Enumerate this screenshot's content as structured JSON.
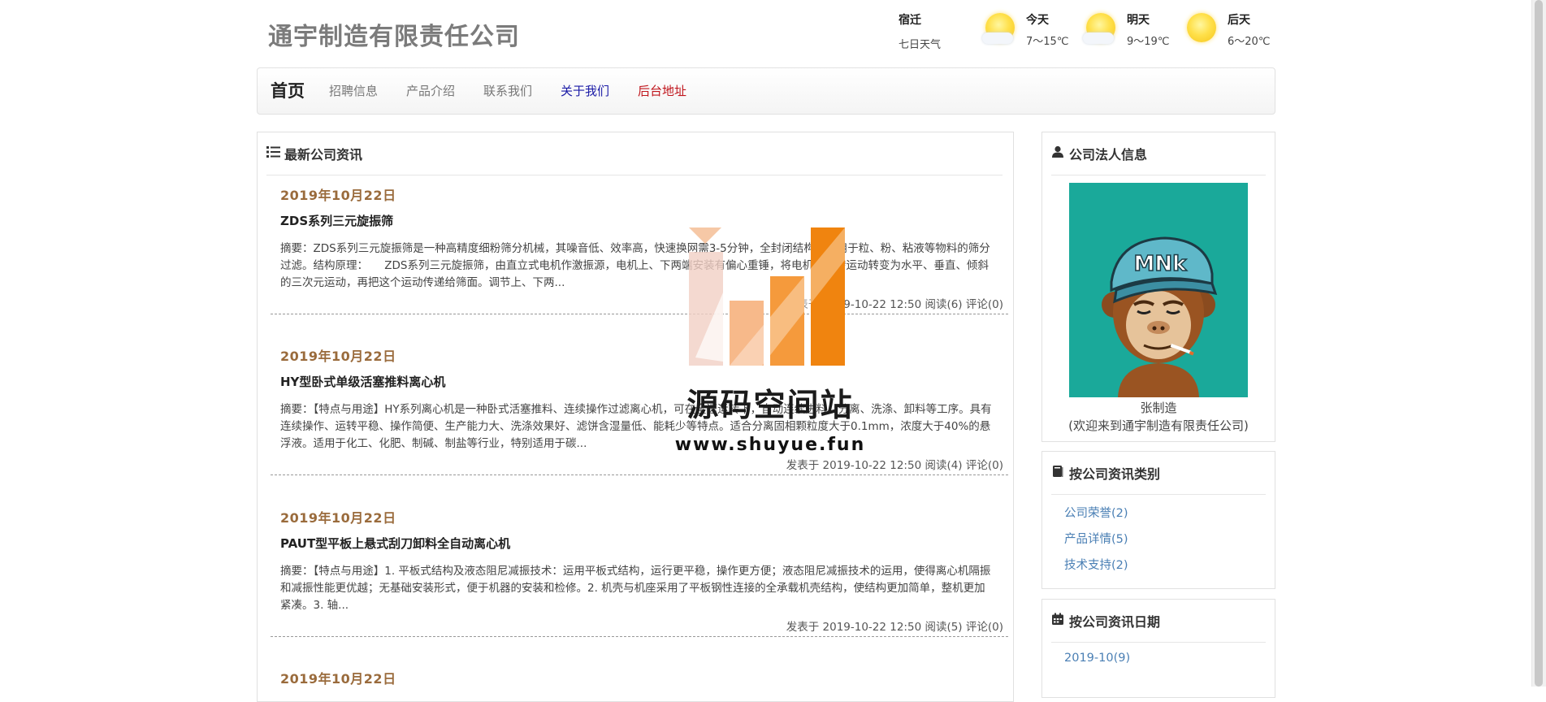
{
  "header": {
    "site_title": "通宇制造有限责任公司",
    "weather": {
      "city": "宿迁",
      "label": "七日天气",
      "days": [
        {
          "name": "今天",
          "temp": "7～15℃",
          "icon": "sun-cloud-icon"
        },
        {
          "name": "明天",
          "temp": "9～19℃",
          "icon": "sun-cloud-icon"
        },
        {
          "name": "后天",
          "temp": "6～20℃",
          "icon": "sun-icon"
        }
      ]
    }
  },
  "nav": {
    "brand": "首页",
    "items": [
      "招聘信息",
      "产品介绍",
      "联系我们",
      "关于我们",
      "后台地址"
    ],
    "colors": {
      "default": "#777777",
      "about": "#1a1aa6",
      "admin": "#c0151c"
    }
  },
  "main": {
    "heading": "最新公司资讯",
    "articles": [
      {
        "date": "2019年10月22日",
        "title": "ZDS系列三元旋振筛",
        "summary": "摘要：ZDS系列三元旋振筛是一种高精度细粉筛分机械，其噪音低、效率高，快速换网需3-5分钟，全封闭结构，适用于粒、粉、粘液等物料的筛分过滤。结构原理：　　ZDS系列三元旋振筛，由直立式电机作激振源，电机上、下两端安装有偏心重锤，将电机的旋转运动转变为水平、垂直、倾斜的三次元运动，再把这个运动传递给筛面。调节上、下两...",
        "meta": "发表于 2019-10-22 12:50 阅读(6) 评论(0)"
      },
      {
        "date": "2019年10月22日",
        "title": "HY型卧式单级活塞推料离心机",
        "summary": "摘要：【特点与用途】HY系列离心机是一种卧式活塞推料、连续操作过滤离心机，可在全速运转下，自动连续进料、分离、洗涤、卸料等工序。具有连续操作、运转平稳、操作简便、生产能力大、洗涤效果好、滤饼含湿量低、能耗少等特点。适合分离固相颗粒度大于0.1mm，浓度大于40%的悬浮液。适用于化工、化肥、制碱、制盐等行业，特别适用于碳...",
        "meta": "发表于 2019-10-22 12:50 阅读(4) 评论(0)"
      },
      {
        "date": "2019年10月22日",
        "title": "PAUT型平板上悬式刮刀卸料全自动离心机",
        "summary": "摘要：【特点与用途】1. 平板式结构及液态阻尼减振技术：运用平板式结构，运行更平稳，操作更方便；液态阻尼减振技术的运用，使得离心机隔振和减振性能更优越；无基础安装形式，便于机器的安装和检修。2. 机壳与机座采用了平板钢性连接的全承载机壳结构，使结构更加简单，整机更加紧凑。3. 轴...",
        "meta": "发表于 2019-10-22 12:50 阅读(5) 评论(0)"
      },
      {
        "date": "2019年10月22日"
      }
    ]
  },
  "sidebar": {
    "legal": {
      "heading": "公司法人信息",
      "name": "张制造",
      "welcome": "(欢迎来到通宇制造有限责任公司)",
      "avatar_cap_text": "MNk"
    },
    "categories": {
      "heading": "按公司资讯类别",
      "items": [
        "公司荣誉(2)",
        "产品详情(5)",
        "技术支持(2)"
      ]
    },
    "dates": {
      "heading": "按公司资讯日期",
      "items": [
        "2019-10(9)"
      ]
    }
  },
  "watermark": {
    "title": "源码空间站",
    "url": "www.shuyue.fun"
  }
}
